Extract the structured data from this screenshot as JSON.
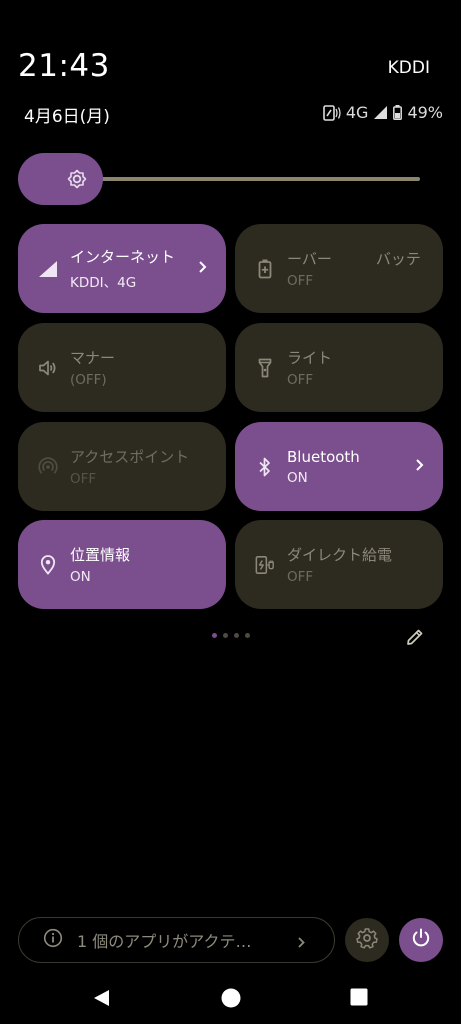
{
  "status_bar": {
    "time": "21:43",
    "carrier": "KDDI",
    "date": "4月6日(月)",
    "network": "4G",
    "battery": "49%"
  },
  "brightness": {
    "level": 0.08
  },
  "tiles": [
    {
      "label": "インターネット",
      "sub": "KDDI、4G",
      "state": "on",
      "icon": "signal-icon",
      "chevron": true
    },
    {
      "label": "ーバー",
      "label2": "バッテ",
      "sub": "OFF",
      "state": "off",
      "icon": "battery-saver-icon"
    },
    {
      "label": "マナー",
      "sub": "(OFF)",
      "state": "off",
      "icon": "volume-icon"
    },
    {
      "label": "ライト",
      "sub": "OFF",
      "state": "off",
      "icon": "flashlight-icon"
    },
    {
      "label": "アクセスポイント",
      "sub": "OFF",
      "state": "off",
      "icon": "hotspot-icon"
    },
    {
      "label": "Bluetooth",
      "sub": "ON",
      "state": "on",
      "icon": "bluetooth-icon",
      "chevron": true
    },
    {
      "label": "位置情報",
      "sub": "ON",
      "state": "on",
      "icon": "location-icon"
    },
    {
      "label": "ダイレクト給電",
      "sub": "OFF",
      "state": "off",
      "icon": "direct-power-icon"
    }
  ],
  "pager": {
    "pages": 4,
    "current": 1
  },
  "footer": {
    "active_apps_text": "1 個のアプリがアクテ…"
  },
  "colors": {
    "accent": "#7b4f8d",
    "tile_off": "#2d2b1f",
    "background": "#000000"
  }
}
